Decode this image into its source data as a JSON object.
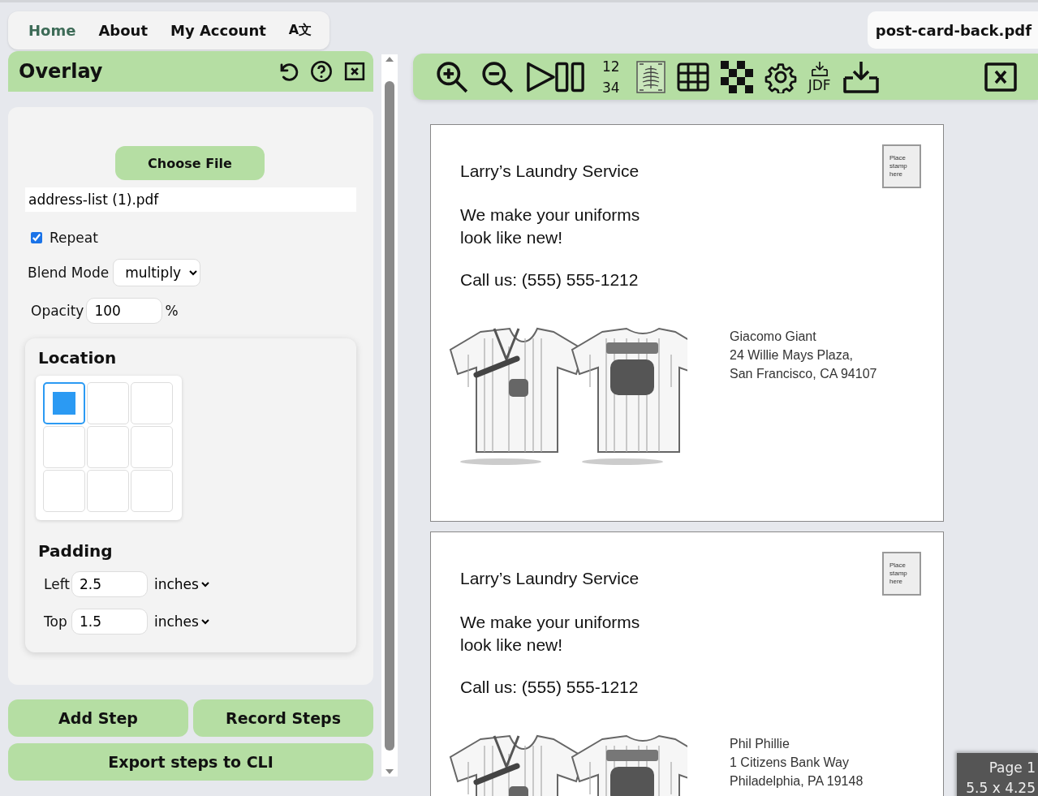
{
  "nav": {
    "items": [
      {
        "label": "Home",
        "selected": true
      },
      {
        "label": "About",
        "selected": false
      },
      {
        "label": "My Account",
        "selected": false
      }
    ],
    "language": "A文"
  },
  "file_tab": "post-card-back.pdf",
  "overlay": {
    "title": "Overlay",
    "choose_button": "Choose File",
    "file_name": "address-list (1).pdf",
    "repeat": {
      "label": "Repeat",
      "checked": true
    },
    "blend_mode": {
      "label": "Blend Mode",
      "value": "multiply"
    },
    "opacity": {
      "label": "Opacity",
      "value": "100",
      "unit": "%"
    },
    "location": {
      "title": "Location",
      "cells": [
        {
          "selected": true
        },
        {
          "selected": false
        },
        {
          "selected": false
        },
        {
          "selected": false
        },
        {
          "selected": false
        },
        {
          "selected": false
        },
        {
          "selected": false
        },
        {
          "selected": false
        },
        {
          "selected": false
        }
      ]
    },
    "padding": {
      "title": "Padding",
      "rows": [
        {
          "label": "Left",
          "value": "2.5",
          "unit": "inches"
        },
        {
          "label": "Top",
          "value": "1.5",
          "unit": "inches"
        }
      ]
    }
  },
  "buttons": [
    "Add Step",
    "Record Steps"
  ],
  "export_button": "Export steps to CLI",
  "toolbar": {
    "page_order": [
      "12",
      "34"
    ],
    "jdf_label": "JDF"
  },
  "pages": [
    {
      "business": "Larry’s Laundry Service",
      "slogan": [
        "We make your uniforms",
        "look like new!"
      ],
      "phone": "Call us: (555) 555-1212",
      "stamp": [
        "Place",
        "stamp",
        "here"
      ],
      "address": [
        "Giacomo Giant",
        "24 Willie Mays Plaza,",
        "San Francisco, CA 94107"
      ]
    },
    {
      "business": "Larry’s Laundry Service",
      "slogan": [
        "We make your uniforms",
        "look like new!"
      ],
      "phone": "Call us: (555) 555-1212",
      "stamp": [
        "Place",
        "stamp",
        "here"
      ],
      "address": [
        "Phil Phillie",
        "1 Citizens Bank Way",
        "Philadelphia, PA 19148"
      ]
    }
  ],
  "page_badge": {
    "label": "Page 1",
    "size": "5.5 x 4.25"
  }
}
